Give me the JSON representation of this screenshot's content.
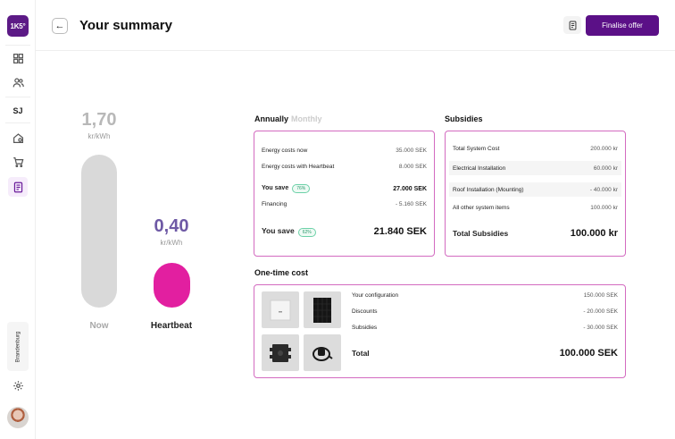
{
  "app": {
    "logo_text": "1K5°"
  },
  "sidebar": {
    "user_initials": "SJ",
    "region": "Brandenburg",
    "items": [
      {
        "name": "dashboard"
      },
      {
        "name": "users"
      },
      {
        "name": "home-settings"
      },
      {
        "name": "cart"
      },
      {
        "name": "offers",
        "active": true
      }
    ]
  },
  "header": {
    "title": "Your summary",
    "finalise_label": "Finalise offer"
  },
  "comparison": {
    "now": {
      "price": "1,70",
      "unit": "kr/kWh",
      "label": "Now"
    },
    "heartbeat": {
      "price": "0,40",
      "unit": "kr/kWh",
      "label": "Heartbeat"
    },
    "heartbeat_fraction_of_now": 0.235
  },
  "annually": {
    "tab_active": "Annually",
    "tab_inactive": "Monthly",
    "rows": [
      {
        "label": "Energy costs now",
        "value": "35.000 SEK"
      },
      {
        "label": "Energy costs with Heartbeat",
        "value": "8.000 SEK"
      },
      {
        "label": "You save",
        "badge": "76%",
        "value": "27.000 SEK"
      },
      {
        "label": "Financing",
        "value": "- 5.160 SEK"
      },
      {
        "label": "You save",
        "badge": "62%",
        "value": "21.840 SEK"
      }
    ]
  },
  "subsidies": {
    "title": "Subsidies",
    "rows": [
      {
        "label": "Total System Cost",
        "value": "200.000 kr"
      },
      {
        "label": "Electrical Installation",
        "value": "60.000 kr"
      },
      {
        "label": "Roof Installation (Mounting)",
        "value": "- 40.000 kr"
      },
      {
        "label": "All other system items",
        "value": "100.000 kr"
      },
      {
        "label": "Total Subsidies",
        "value": "100.000 kr"
      }
    ]
  },
  "one_time": {
    "title": "One-time cost",
    "rows": [
      {
        "label": "Your configuration",
        "value": "150.000 SEK"
      },
      {
        "label": "Discounts",
        "value": "- 20.000 SEK"
      },
      {
        "label": "Subsidies",
        "value": "- 30.000 SEK"
      },
      {
        "label": "Total",
        "value": "100.000 SEK"
      }
    ],
    "products": [
      "inverter",
      "solar-panel",
      "battery",
      "charger"
    ]
  },
  "colors": {
    "brand": "#5b1087",
    "heartbeat": "#e21fa0",
    "card_border": "#d36bc0",
    "badge": "#2b9a6d"
  }
}
